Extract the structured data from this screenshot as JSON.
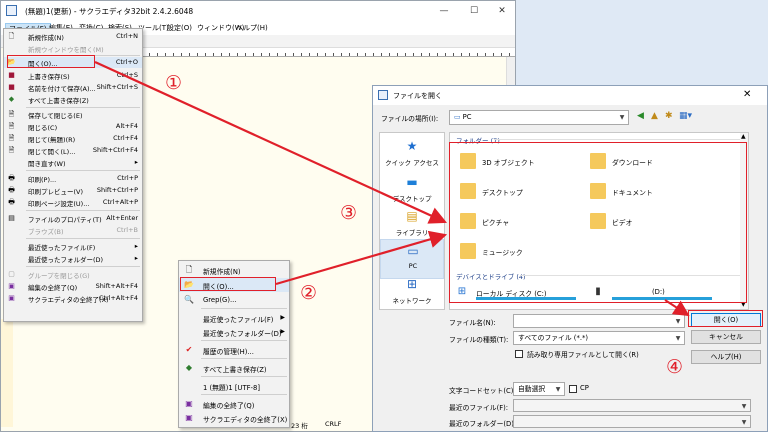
{
  "editor": {
    "title": "(無題)1(更新) - サクラエディタ32bit 2.4.2.6048",
    "menu": [
      "ファイル(F)",
      "編集(E)",
      "変換(C)",
      "検索(S)",
      "ツール(T)",
      "設定(O)",
      "ウィンドウ(W)",
      "ヘルプ(H)"
    ],
    "status": {
      "col": "23 桁",
      "eol": "CRLF"
    }
  },
  "file_menu": {
    "items": [
      {
        "label": "新規作成(N)",
        "shortcut": "Ctrl+N",
        "icon": "new-doc-icon",
        "disabled": false
      },
      {
        "label": "新規ウインドウを開く(M)",
        "shortcut": "",
        "icon": "",
        "disabled": true
      },
      {
        "label": "開く(O)...",
        "shortcut": "Ctrl+O",
        "icon": "open-folder-icon",
        "disabled": false
      },
      {
        "label": "上書き保存(S)",
        "shortcut": "Ctrl+S",
        "icon": "save-icon",
        "disabled": false
      },
      {
        "label": "名前を付けて保存(A)...",
        "shortcut": "Shift+Ctrl+S",
        "icon": "save-as-icon",
        "disabled": false
      },
      {
        "label": "すべて上書き保存(Z)",
        "shortcut": "",
        "icon": "save-all-icon",
        "disabled": false
      },
      {
        "label": "保存して閉じる(E)",
        "shortcut": "",
        "icon": "save-close-icon",
        "disabled": false
      },
      {
        "label": "閉じる(C)",
        "shortcut": "Alt+F4",
        "icon": "close-doc-icon",
        "disabled": false
      },
      {
        "label": "閉じて(無題)(R)",
        "shortcut": "Ctrl+F4",
        "icon": "close-untitled-icon",
        "disabled": false
      },
      {
        "label": "閉じて開く(L)...",
        "shortcut": "Shift+Ctrl+F4",
        "icon": "close-open-icon",
        "disabled": false
      },
      {
        "label": "開き直す(W)",
        "shortcut": "",
        "icon": "",
        "disabled": false,
        "submenu": true
      },
      {
        "label": "印刷(P)...",
        "shortcut": "Ctrl+P",
        "icon": "print-icon",
        "disabled": false
      },
      {
        "label": "印刷プレビュー(V)",
        "shortcut": "Shift+Ctrl+P",
        "icon": "print-preview-icon",
        "disabled": false
      },
      {
        "label": "印刷ページ設定(U)...",
        "shortcut": "Ctrl+Alt+P",
        "icon": "page-setup-icon",
        "disabled": false
      },
      {
        "label": "ファイルのプロパティ(T)",
        "shortcut": "Alt+Enter",
        "icon": "properties-icon",
        "disabled": false
      },
      {
        "label": "ブラウズ(B)",
        "shortcut": "Ctrl+B",
        "icon": "",
        "disabled": true
      },
      {
        "label": "最近使ったファイル(F)",
        "shortcut": "",
        "icon": "",
        "disabled": false,
        "submenu": true
      },
      {
        "label": "最近使ったフォルダー(D)",
        "shortcut": "",
        "icon": "",
        "disabled": false,
        "submenu": true
      },
      {
        "label": "グループを閉じる(G)",
        "shortcut": "",
        "icon": "group-close-icon",
        "disabled": true
      },
      {
        "label": "編集の全終了(Q)",
        "shortcut": "Shift+Alt+F4",
        "icon": "exit-edit-icon",
        "disabled": false
      },
      {
        "label": "サクラエディタの全終了(X)",
        "shortcut": "Ctrl+Alt+F4",
        "icon": "exit-all-icon",
        "disabled": false
      }
    ]
  },
  "context_menu": {
    "items": [
      {
        "label": "新規作成(N)",
        "icon": "new-doc-icon"
      },
      {
        "label": "開く(O)...",
        "icon": "open-folder-icon"
      },
      {
        "label": "Grep(G)...",
        "icon": "grep-icon"
      },
      {
        "label": "最近使ったファイル(F)",
        "icon": "",
        "submenu": true
      },
      {
        "label": "最近使ったフォルダー(D)",
        "icon": "",
        "submenu": true
      },
      {
        "label": "履歴の管理(H)...",
        "icon": "check-icon"
      },
      {
        "label": "すべて上書き保存(Z)",
        "icon": "save-all-icon"
      },
      {
        "label": "1 (無題)1 [UTF-8]",
        "icon": ""
      },
      {
        "label": "編集の全終了(Q)",
        "icon": "exit-edit-icon"
      },
      {
        "label": "サクラエディタの全終了(X)",
        "icon": "exit-all-icon"
      }
    ]
  },
  "dialog": {
    "title": "ファイルを開く",
    "location_label": "ファイルの場所(I):",
    "location_value": "PC",
    "places": [
      {
        "label": "クイック アクセス",
        "icon": "star-icon"
      },
      {
        "label": "デスクトップ",
        "icon": "desktop-icon"
      },
      {
        "label": "ライブラリ",
        "icon": "library-icon"
      },
      {
        "label": "PC",
        "icon": "pc-icon"
      },
      {
        "label": "ネットワーク",
        "icon": "network-icon"
      }
    ],
    "folders_header": "フォルダー (7)",
    "folders": [
      {
        "label": "3D オブジェクト",
        "icon": "folder-3d-icon"
      },
      {
        "label": "ダウンロード",
        "icon": "folder-download-icon"
      },
      {
        "label": "デスクトップ",
        "icon": "folder-desktop-icon"
      },
      {
        "label": "ドキュメント",
        "icon": "folder-documents-icon"
      },
      {
        "label": "ピクチャ",
        "icon": "folder-pictures-icon"
      },
      {
        "label": "ビデオ",
        "icon": "folder-videos-icon"
      },
      {
        "label": "ミュージック",
        "icon": "folder-music-icon"
      }
    ],
    "drives_header": "デバイスとドライブ (4)",
    "drives": [
      {
        "label": "ローカル ディスク (C:)",
        "icon": "drive-icon"
      },
      {
        "label": "(D:)",
        "icon": "usb-drive-icon"
      }
    ],
    "filename_label": "ファイル名(N):",
    "filename_value": "",
    "filetype_label": "ファイルの種類(T):",
    "filetype_value": "すべてのファイル (*.*)",
    "readonly_label": "読み取り専用ファイルとして開く(R)",
    "open_button": "開く(O)",
    "cancel_button": "キャンセル",
    "help_button": "ヘルプ(H)",
    "charset_label": "文字コードセット(C):",
    "charset_value": "自動選択",
    "cp_label": "CP",
    "recent_file_label": "最近のファイル(F):",
    "recent_folder_label": "最近のフォルダー(D):"
  },
  "annotations": {
    "step1": "①",
    "step2": "②",
    "step3": "③",
    "step4": "④",
    "color": "#e0202a"
  }
}
